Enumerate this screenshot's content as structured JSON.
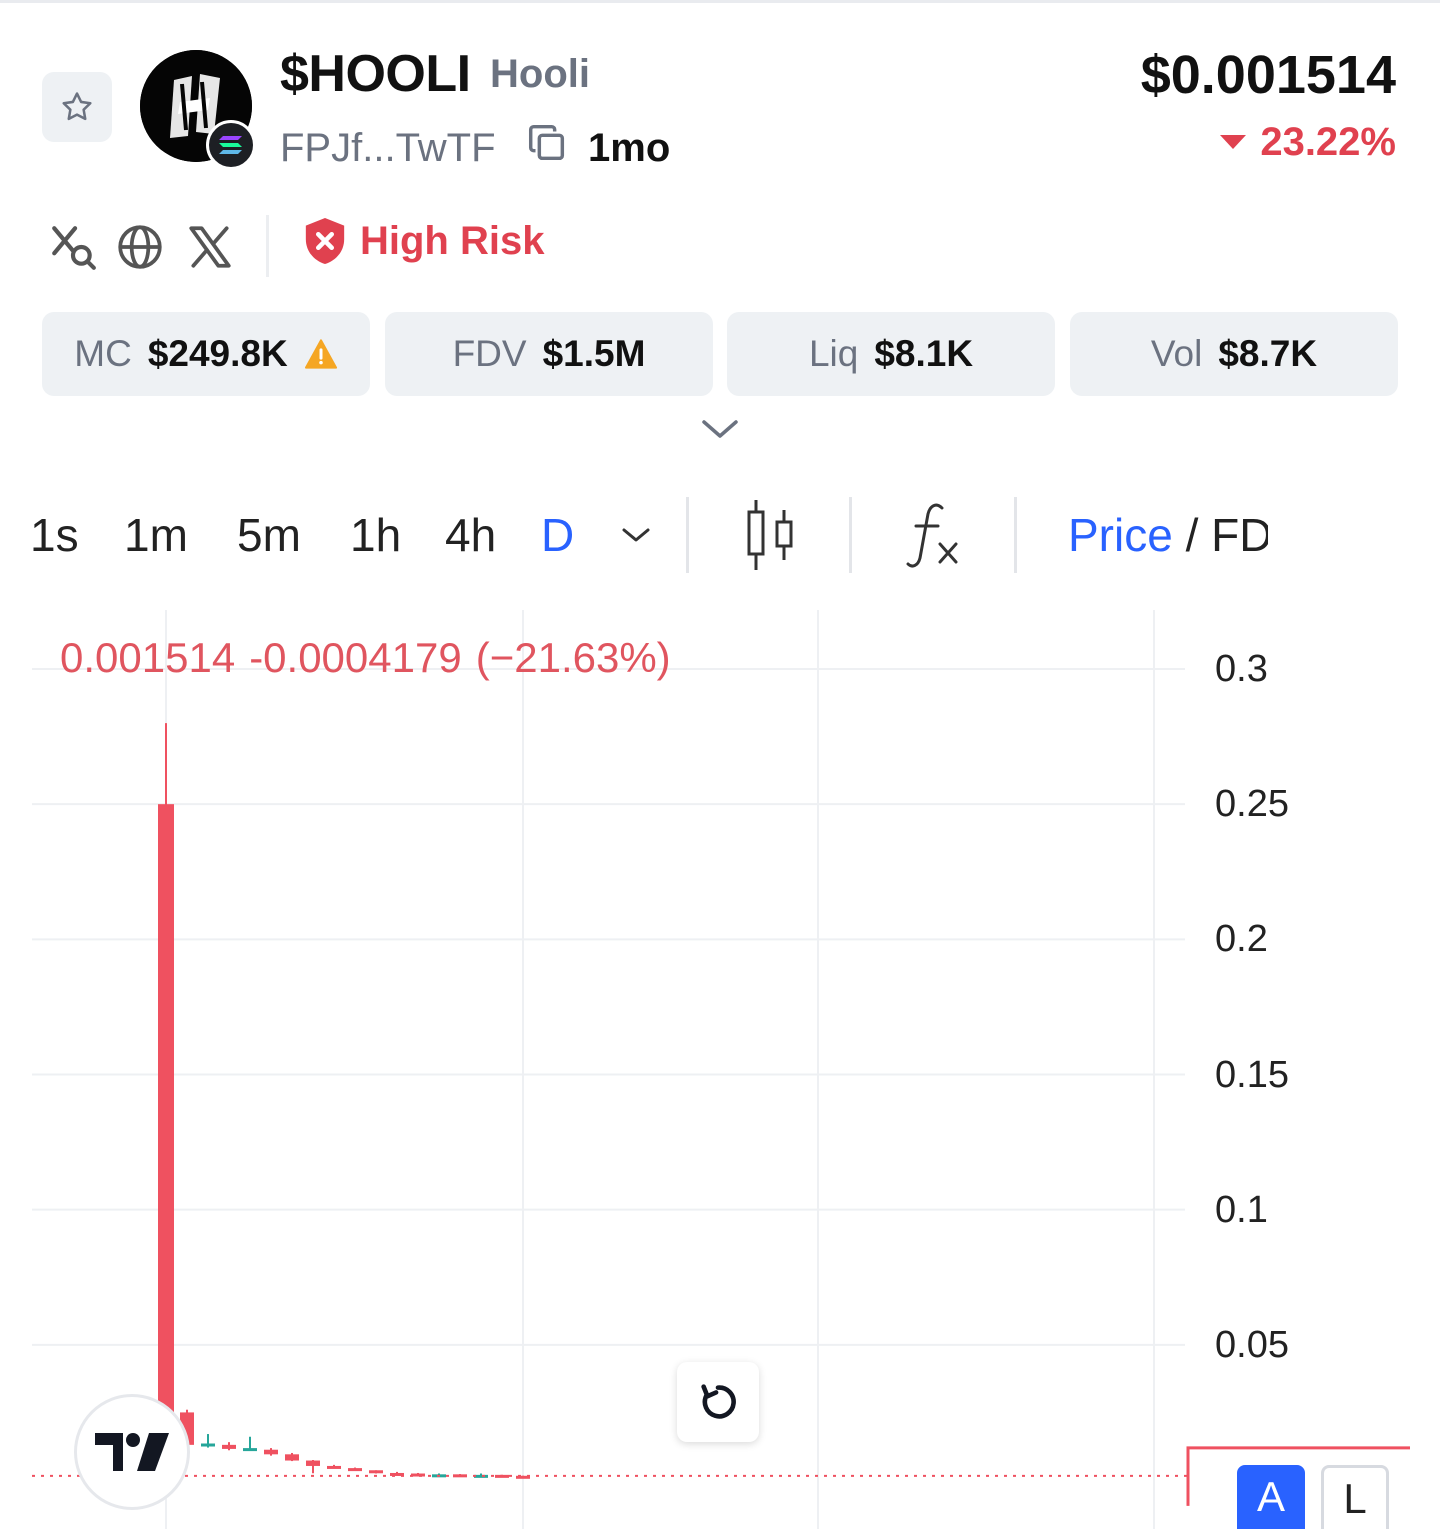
{
  "token": {
    "ticker": "$HOOLI",
    "name": "Hooli",
    "address_short": "FPJf...TwTF",
    "age": "1mo",
    "price": "$0.001514",
    "change": "23.22%",
    "change_direction": "down"
  },
  "risk": {
    "label": "High Risk",
    "color": "#e0414f"
  },
  "socials": [
    "x-search-icon",
    "globe-icon",
    "x-logo-icon"
  ],
  "stats": [
    {
      "label": "MC",
      "value": "$249.8K",
      "warning": true
    },
    {
      "label": "FDV",
      "value": "$1.5M"
    },
    {
      "label": "Liq",
      "value": "$8.1K"
    },
    {
      "label": "Vol",
      "value": "$8.7K"
    }
  ],
  "timeframes": [
    "1s",
    "1m",
    "5m",
    "1h",
    "4h",
    "D"
  ],
  "active_timeframe": "D",
  "price_toggle": {
    "active": "Price",
    "separator": " / ",
    "other": "FD"
  },
  "chart_legend": {
    "close": "0.001514",
    "change": "-0.0004179",
    "change_pct": "(−21.63%)"
  },
  "scale_buttons": {
    "auto": "A",
    "log": "L"
  },
  "colors": {
    "accent": "#2962ff",
    "down": "#ef5160",
    "up": "#26a69a"
  },
  "chart_data": {
    "type": "candlestick",
    "y_ticks": [
      "0.3",
      "0.25",
      "0.2",
      "0.15",
      "0.1",
      "0.05"
    ],
    "ylim": [
      0,
      0.3
    ],
    "last_price": 0.001514,
    "candles": [
      {
        "o": 0.25,
        "h": 0.28,
        "l": 0.018,
        "c": 0.025
      },
      {
        "o": 0.025,
        "h": 0.026,
        "l": 0.012,
        "c": 0.013
      },
      {
        "o": 0.013,
        "h": 0.017,
        "l": 0.012,
        "c": 0.0135
      },
      {
        "o": 0.013,
        "h": 0.014,
        "l": 0.011,
        "c": 0.0115
      },
      {
        "o": 0.0115,
        "h": 0.016,
        "l": 0.011,
        "c": 0.0118
      },
      {
        "o": 0.0112,
        "h": 0.0118,
        "l": 0.009,
        "c": 0.0095
      },
      {
        "o": 0.0095,
        "h": 0.01,
        "l": 0.007,
        "c": 0.0072
      },
      {
        "o": 0.0072,
        "h": 0.0074,
        "l": 0.0025,
        "c": 0.0052
      },
      {
        "o": 0.0052,
        "h": 0.0056,
        "l": 0.0048,
        "c": 0.005
      },
      {
        "o": 0.0044,
        "h": 0.0046,
        "l": 0.0034,
        "c": 0.0036
      },
      {
        "o": 0.0036,
        "h": 0.0036,
        "l": 0.0024,
        "c": 0.0026
      },
      {
        "o": 0.0026,
        "h": 0.003,
        "l": 0.0022,
        "c": 0.0024
      },
      {
        "o": 0.0024,
        "h": 0.0026,
        "l": 0.0019,
        "c": 0.002
      },
      {
        "o": 0.002,
        "h": 0.0024,
        "l": 0.0018,
        "c": 0.0021
      },
      {
        "o": 0.0021,
        "h": 0.0022,
        "l": 0.0016,
        "c": 0.0017
      },
      {
        "o": 0.0017,
        "h": 0.0024,
        "l": 0.0016,
        "c": 0.0019
      },
      {
        "o": 0.0019,
        "h": 0.0019,
        "l": 0.0015,
        "c": 0.00155
      },
      {
        "o": 0.00155,
        "h": 0.0016,
        "l": 0.0014,
        "c": 0.001514
      }
    ]
  }
}
